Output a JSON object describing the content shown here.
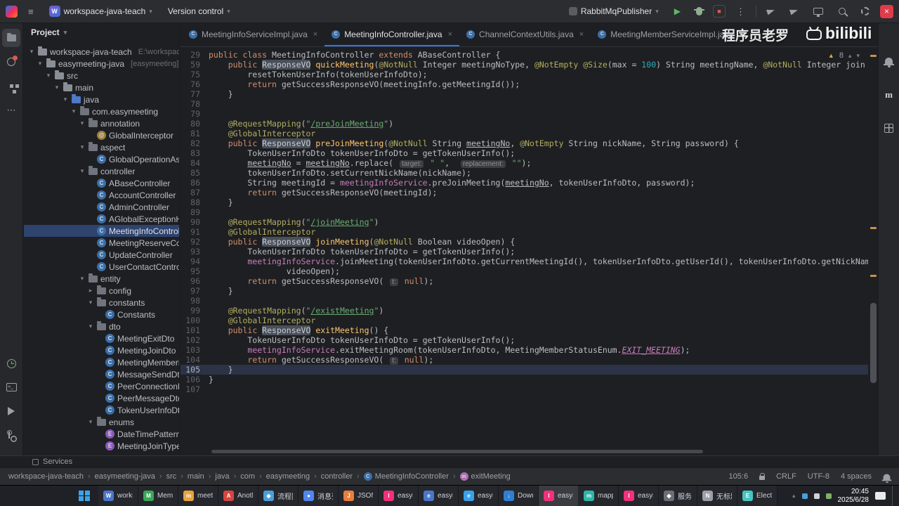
{
  "icons": {
    "hamburger": "≡",
    "chevron_down": "▾",
    "chevron_right": "▸",
    "chevron_up": "▴",
    "play": "▶",
    "stop": "■",
    "kebab": "⋮",
    "more": "⋯",
    "close": "×",
    "warning_triangle": "▲",
    "breadcrumb_sep": "›"
  },
  "titlebar": {
    "project_badge": "W",
    "project_name": "workspace-java-teach",
    "vcs_label": "Version control",
    "run_config": "RabbitMqPublisher"
  },
  "watermarks": {
    "channel": "程序员老罗",
    "site": "bilibili"
  },
  "project_panel": {
    "title": "Project",
    "tree": [
      {
        "label": "workspace-java-teach",
        "suffix": "E:\\workspace-java-tea",
        "level": 0,
        "chev": "down",
        "icon": "folder"
      },
      {
        "label": "easymeeting-java",
        "suffix": "[easymeeting]",
        "level": 1,
        "chev": "down",
        "icon": "folder"
      },
      {
        "label": "src",
        "level": 2,
        "chev": "down",
        "icon": "folder"
      },
      {
        "label": "main",
        "level": 3,
        "chev": "down",
        "icon": "folder"
      },
      {
        "label": "java",
        "level": 4,
        "chev": "down",
        "icon": "folder-src"
      },
      {
        "label": "com.easymeeting",
        "level": 5,
        "chev": "down",
        "icon": "package"
      },
      {
        "label": "annotation",
        "level": 6,
        "chev": "down",
        "icon": "package"
      },
      {
        "label": "GlobalInterceptor",
        "level": 7,
        "icon": "annotation"
      },
      {
        "label": "aspect",
        "level": 6,
        "chev": "down",
        "icon": "package"
      },
      {
        "label": "GlobalOperationAspe",
        "level": 7,
        "icon": "class"
      },
      {
        "label": "controller",
        "level": 6,
        "chev": "down",
        "icon": "package"
      },
      {
        "label": "ABaseController",
        "level": 7,
        "icon": "class"
      },
      {
        "label": "AccountController",
        "level": 7,
        "icon": "class"
      },
      {
        "label": "AdminController",
        "level": 7,
        "icon": "class"
      },
      {
        "label": "AGlobalExceptionHan",
        "level": 7,
        "icon": "class"
      },
      {
        "label": "MeetingInfoControlle",
        "level": 7,
        "icon": "class",
        "selected": true
      },
      {
        "label": "MeetingReserveCont",
        "level": 7,
        "icon": "class"
      },
      {
        "label": "UpdateController",
        "level": 7,
        "icon": "class"
      },
      {
        "label": "UserContactControlle",
        "level": 7,
        "icon": "class"
      },
      {
        "label": "entity",
        "level": 6,
        "chev": "down",
        "icon": "package"
      },
      {
        "label": "config",
        "level": 7,
        "chev": "right",
        "icon": "package"
      },
      {
        "label": "constants",
        "level": 7,
        "chev": "down",
        "icon": "package"
      },
      {
        "label": "Constants",
        "level": 8,
        "icon": "class"
      },
      {
        "label": "dto",
        "level": 7,
        "chev": "down",
        "icon": "package"
      },
      {
        "label": "MeetingExitDto",
        "level": 8,
        "icon": "class"
      },
      {
        "label": "MeetingJoinDto",
        "level": 8,
        "icon": "class"
      },
      {
        "label": "MeetingMemberD",
        "level": 8,
        "icon": "class"
      },
      {
        "label": "MessageSendDto",
        "level": 8,
        "icon": "class"
      },
      {
        "label": "PeerConnectionDa",
        "level": 8,
        "icon": "class"
      },
      {
        "label": "PeerMessageDto",
        "level": 8,
        "icon": "class"
      },
      {
        "label": "TokenUserInfoDto",
        "level": 8,
        "icon": "class"
      },
      {
        "label": "enums",
        "level": 7,
        "chev": "down",
        "icon": "package"
      },
      {
        "label": "DateTimePatternE",
        "level": 8,
        "icon": "enum"
      },
      {
        "label": "MeetingJoinTypeE",
        "level": 8,
        "icon": "enum"
      }
    ]
  },
  "tabs": {
    "warning_count": "8",
    "items": [
      {
        "label": "MeetingInfoServiceImpl.java",
        "active": false
      },
      {
        "label": "MeetingInfoController.java",
        "active": true
      },
      {
        "label": "ChannelContextUtils.java",
        "active": false
      },
      {
        "label": "MeetingMemberServiceImpl.java",
        "active": false
      }
    ]
  },
  "editor": {
    "stripe_marks": [
      0.02,
      0.45,
      0.57,
      0.65,
      0.79
    ],
    "scrollbar": {
      "top": 0.64,
      "height": 0.2
    },
    "lines": [
      {
        "n": 29,
        "segs": [
          [
            "public class ",
            "k"
          ],
          [
            "MeetingInfoController ",
            "t"
          ],
          [
            "extends ",
            "k"
          ],
          [
            "ABaseController {",
            "t"
          ]
        ]
      },
      {
        "n": 59,
        "segs": [
          [
            "    ",
            "t"
          ],
          [
            "public ",
            "k"
          ],
          [
            "ResponseVO",
            "hl"
          ],
          [
            " ",
            "t"
          ],
          [
            "quickMeeting",
            "m"
          ],
          [
            "(",
            "t"
          ],
          [
            "@NotNull",
            "a"
          ],
          [
            " Integer meetingNoType, ",
            "t"
          ],
          [
            "@NotEmpty",
            "a"
          ],
          [
            " ",
            "t"
          ],
          [
            "@Size",
            "a"
          ],
          [
            "(max = ",
            "t"
          ],
          [
            "100",
            "n"
          ],
          [
            ") String meetingName, ",
            "t"
          ],
          [
            "@NotNull",
            "a"
          ],
          [
            " Integer join",
            "t"
          ]
        ]
      },
      {
        "n": 75,
        "segs": [
          [
            "        resetTokenUserInfo(tokenUserInfoDto);",
            "t"
          ]
        ]
      },
      {
        "n": 76,
        "segs": [
          [
            "        ",
            "t"
          ],
          [
            "return ",
            "k"
          ],
          [
            "getSuccessResponseVO(meetingInfo.getMeetingId());",
            "t"
          ]
        ]
      },
      {
        "n": 77,
        "segs": [
          [
            "    }",
            "t"
          ]
        ]
      },
      {
        "n": 78,
        "segs": []
      },
      {
        "n": 79,
        "segs": []
      },
      {
        "n": 80,
        "segs": [
          [
            "    ",
            "t"
          ],
          [
            "@RequestMapping",
            "a"
          ],
          [
            "(",
            "t"
          ],
          [
            "\"",
            "s"
          ],
          [
            "/preJoinMeeting",
            "su"
          ],
          [
            "\"",
            "s"
          ],
          [
            ")",
            "t"
          ]
        ]
      },
      {
        "n": 81,
        "segs": [
          [
            "    ",
            "t"
          ],
          [
            "@GlobalInterceptor",
            "a"
          ]
        ]
      },
      {
        "n": 82,
        "segs": [
          [
            "    ",
            "t"
          ],
          [
            "public ",
            "k"
          ],
          [
            "ResponseVO",
            "hl"
          ],
          [
            " ",
            "t"
          ],
          [
            "preJoinMeeting",
            "m"
          ],
          [
            "(",
            "t"
          ],
          [
            "@NotNull",
            "a"
          ],
          [
            " String ",
            "t"
          ],
          [
            "meetingNo",
            "u"
          ],
          [
            ", ",
            "t"
          ],
          [
            "@NotEmpty",
            "a"
          ],
          [
            " String nickName, String password) {",
            "t"
          ]
        ]
      },
      {
        "n": 83,
        "segs": [
          [
            "        TokenUserInfoDto tokenUserInfoDto = getTokenUserInfo();",
            "t"
          ]
        ]
      },
      {
        "n": 84,
        "segs": [
          [
            "        ",
            "t"
          ],
          [
            "meetingNo",
            "u"
          ],
          [
            " = ",
            "t"
          ],
          [
            "meetingNo",
            "u"
          ],
          [
            ".replace( ",
            "t"
          ],
          [
            "target:",
            "h"
          ],
          [
            " ",
            "t"
          ],
          [
            "\" \"",
            "s"
          ],
          [
            ",  ",
            "t"
          ],
          [
            "replacement:",
            "h"
          ],
          [
            " ",
            "t"
          ],
          [
            "\"\"",
            "s"
          ],
          [
            ");",
            "t"
          ]
        ]
      },
      {
        "n": 85,
        "segs": [
          [
            "        tokenUserInfoDto.setCurrentNickName(nickName);",
            "t"
          ]
        ]
      },
      {
        "n": 86,
        "segs": [
          [
            "        String meetingId = ",
            "t"
          ],
          [
            "meetingInfoService",
            "f"
          ],
          [
            ".preJoinMeeting(",
            "t"
          ],
          [
            "meetingNo",
            "u"
          ],
          [
            ", tokenUserInfoDto, password);",
            "t"
          ]
        ]
      },
      {
        "n": 87,
        "segs": [
          [
            "        ",
            "t"
          ],
          [
            "return ",
            "k"
          ],
          [
            "getSuccessResponseVO(meetingId);",
            "t"
          ]
        ]
      },
      {
        "n": 88,
        "segs": [
          [
            "    }",
            "t"
          ]
        ]
      },
      {
        "n": 89,
        "segs": []
      },
      {
        "n": 90,
        "segs": [
          [
            "    ",
            "t"
          ],
          [
            "@RequestMapping",
            "a"
          ],
          [
            "(",
            "t"
          ],
          [
            "\"",
            "s"
          ],
          [
            "/joinMeeting",
            "su"
          ],
          [
            "\"",
            "s"
          ],
          [
            ")",
            "t"
          ]
        ]
      },
      {
        "n": 91,
        "segs": [
          [
            "    ",
            "t"
          ],
          [
            "@GlobalInterceptor",
            "a"
          ]
        ]
      },
      {
        "n": 92,
        "segs": [
          [
            "    ",
            "t"
          ],
          [
            "public ",
            "k"
          ],
          [
            "ResponseVO",
            "hl"
          ],
          [
            " ",
            "t"
          ],
          [
            "joinMeeting",
            "m"
          ],
          [
            "(",
            "t"
          ],
          [
            "@NotNull",
            "a"
          ],
          [
            " Boolean videoOpen) {",
            "t"
          ]
        ]
      },
      {
        "n": 93,
        "segs": [
          [
            "        TokenUserInfoDto tokenUserInfoDto = getTokenUserInfo();",
            "t"
          ]
        ]
      },
      {
        "n": 94,
        "segs": [
          [
            "        ",
            "t"
          ],
          [
            "meetingInfoService",
            "f"
          ],
          [
            ".joinMeeting(tokenUserInfoDto.getCurrentMeetingId(), tokenUserInfoDto.getUserId(), tokenUserInfoDto.getNickName(),",
            "t"
          ]
        ]
      },
      {
        "n": 95,
        "segs": [
          [
            "                videoOpen);",
            "t"
          ]
        ]
      },
      {
        "n": 96,
        "segs": [
          [
            "        ",
            "t"
          ],
          [
            "return ",
            "k"
          ],
          [
            "getSuccessResponseVO( ",
            "t"
          ],
          [
            "t:",
            "h"
          ],
          [
            " ",
            "t"
          ],
          [
            "null",
            "k"
          ],
          [
            ");",
            "t"
          ]
        ]
      },
      {
        "n": 97,
        "segs": [
          [
            "    }",
            "t"
          ]
        ]
      },
      {
        "n": 98,
        "segs": []
      },
      {
        "n": 99,
        "segs": [
          [
            "    ",
            "t"
          ],
          [
            "@RequestMapping",
            "a"
          ],
          [
            "(",
            "t"
          ],
          [
            "\"",
            "s"
          ],
          [
            "/existMeeting",
            "su"
          ],
          [
            "\"",
            "s"
          ],
          [
            ")",
            "t"
          ]
        ]
      },
      {
        "n": 100,
        "segs": [
          [
            "    ",
            "t"
          ],
          [
            "@GlobalInterceptor",
            "a"
          ]
        ]
      },
      {
        "n": 101,
        "segs": [
          [
            "    ",
            "t"
          ],
          [
            "public ",
            "k"
          ],
          [
            "ResponseVO",
            "hl"
          ],
          [
            " ",
            "t"
          ],
          [
            "exitMeeting",
            "m"
          ],
          [
            "() {",
            "t"
          ]
        ]
      },
      {
        "n": 102,
        "segs": [
          [
            "        TokenUserInfoDto tokenUserInfoDto = getTokenUserInfo();",
            "t"
          ]
        ]
      },
      {
        "n": 103,
        "segs": [
          [
            "        ",
            "t"
          ],
          [
            "meetingInfoService",
            "f"
          ],
          [
            ".exitMeetingRoom(tokenUserInfoDto, MeetingMemberStatusEnum.",
            "t"
          ],
          [
            "EXIT_MEETING",
            "c"
          ],
          [
            ");",
            "t"
          ]
        ]
      },
      {
        "n": 104,
        "segs": [
          [
            "        ",
            "t"
          ],
          [
            "return ",
            "k"
          ],
          [
            "getSuccessResponseVO( ",
            "t"
          ],
          [
            "t:",
            "h"
          ],
          [
            " ",
            "t"
          ],
          [
            "null",
            "k"
          ],
          [
            ");",
            "t"
          ]
        ]
      },
      {
        "n": 105,
        "cur": true,
        "segs": [
          [
            "    }",
            "t"
          ]
        ]
      },
      {
        "n": 106,
        "segs": [
          [
            "}",
            "t"
          ]
        ]
      },
      {
        "n": 107,
        "segs": []
      }
    ]
  },
  "services": {
    "label": "Services"
  },
  "statusbar": {
    "breadcrumbs": [
      {
        "label": "workspace-java-teach"
      },
      {
        "label": "easymeeting-java"
      },
      {
        "label": "src"
      },
      {
        "label": "main"
      },
      {
        "label": "java"
      },
      {
        "label": "com"
      },
      {
        "label": "easymeeting"
      },
      {
        "label": "controller"
      },
      {
        "label": "MeetingInfoController",
        "icon": "class"
      },
      {
        "label": "exitMeeting",
        "icon": "method"
      }
    ],
    "right": {
      "caret": "105:6",
      "line_sep": "CRLF",
      "encoding": "UTF-8",
      "indent": "4 spaces"
    }
  },
  "taskbar": {
    "apps": [
      {
        "label": "works",
        "glyph": "W",
        "color": "#4a76c9"
      },
      {
        "label": "Memt",
        "glyph": "M",
        "color": "#3aa757"
      },
      {
        "label": "meeti",
        "glyph": "m",
        "color": "#e8a33d"
      },
      {
        "label": "Anoth",
        "glyph": "A",
        "color": "#d64541"
      },
      {
        "label": "流程图",
        "glyph": "◆",
        "color": "#4a9fd8"
      },
      {
        "label": "消息列",
        "glyph": "●",
        "color": "#5186ec"
      },
      {
        "label": "JSONK",
        "glyph": "J",
        "color": "#e87d3e"
      },
      {
        "label": "easym",
        "glyph": "I",
        "color": "#f0317b"
      },
      {
        "label": "easym",
        "glyph": "e",
        "color": "#4a76c9"
      },
      {
        "label": "easym",
        "glyph": "e",
        "color": "#3aa0e8"
      },
      {
        "label": "Down",
        "glyph": "↓",
        "color": "#2f7fd3"
      },
      {
        "label": "easym",
        "glyph": "I",
        "color": "#f0317b",
        "active": true
      },
      {
        "label": "mapp",
        "glyph": "m",
        "color": "#2fb5a8"
      },
      {
        "label": "easym",
        "glyph": "I",
        "color": "#f0317b"
      },
      {
        "label": "服务",
        "glyph": "◆",
        "color": "#6c7076"
      },
      {
        "label": "无标题",
        "glyph": "N",
        "color": "#9ba0a8"
      },
      {
        "label": "Electr",
        "glyph": "E",
        "color": "#47c5c0"
      }
    ],
    "tray": {
      "time": "20:45",
      "date": "2025/6/28"
    }
  }
}
